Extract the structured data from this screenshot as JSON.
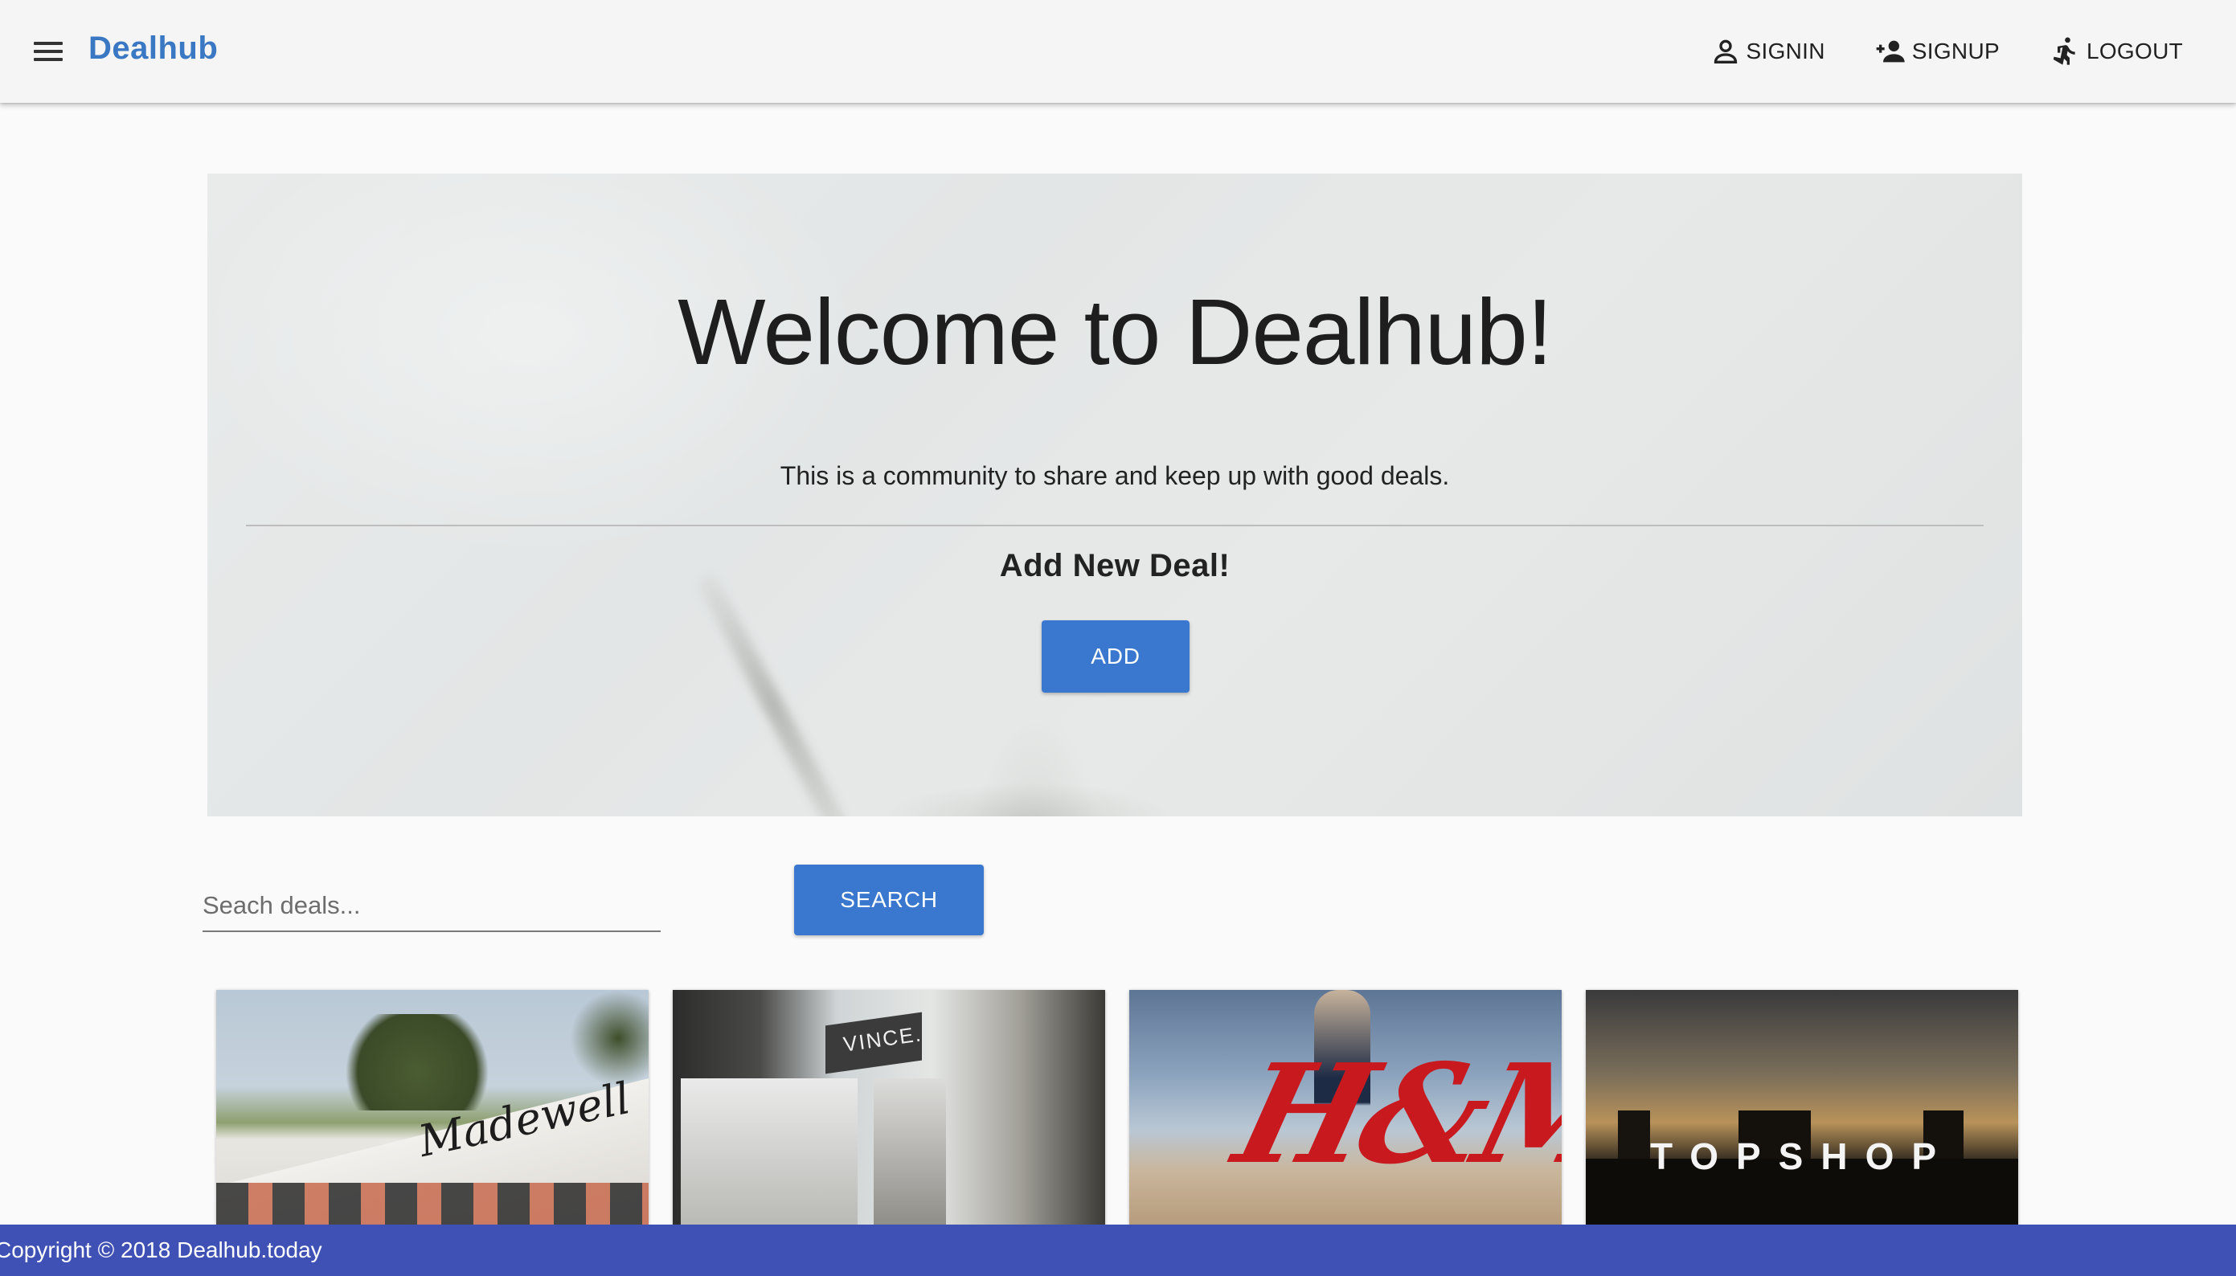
{
  "appbar": {
    "brand": "Dealhub",
    "nav": {
      "signin": "SIGNIN",
      "signup": "SIGNUP",
      "logout": "LOGOUT"
    }
  },
  "hero": {
    "title": "Welcome to Dealhub!",
    "subtitle": "This is a community to share and keep up with good deals.",
    "add_heading": "Add New Deal!",
    "add_button": "ADD"
  },
  "search": {
    "placeholder": "Seach deals...",
    "value": "",
    "button": "SEARCH"
  },
  "cards": [
    {
      "store": "Madewell",
      "logo_text": "Madewell"
    },
    {
      "store": "Vince",
      "logo_text": "VINCE."
    },
    {
      "store": "H&M",
      "logo_text": "H&M"
    },
    {
      "store": "Topshop",
      "logo_text": "TOPSHOP"
    }
  ],
  "footer": {
    "copyright": "Copyright © 2018 Dealhub.today"
  },
  "colors": {
    "brand": "#3a78c4",
    "primary_button": "#3a78cf",
    "footer": "#3f51b5",
    "appbar": "#f5f5f5"
  },
  "icons": [
    "menu-icon",
    "person-outline-icon",
    "person-add-icon",
    "running-person-icon"
  ]
}
